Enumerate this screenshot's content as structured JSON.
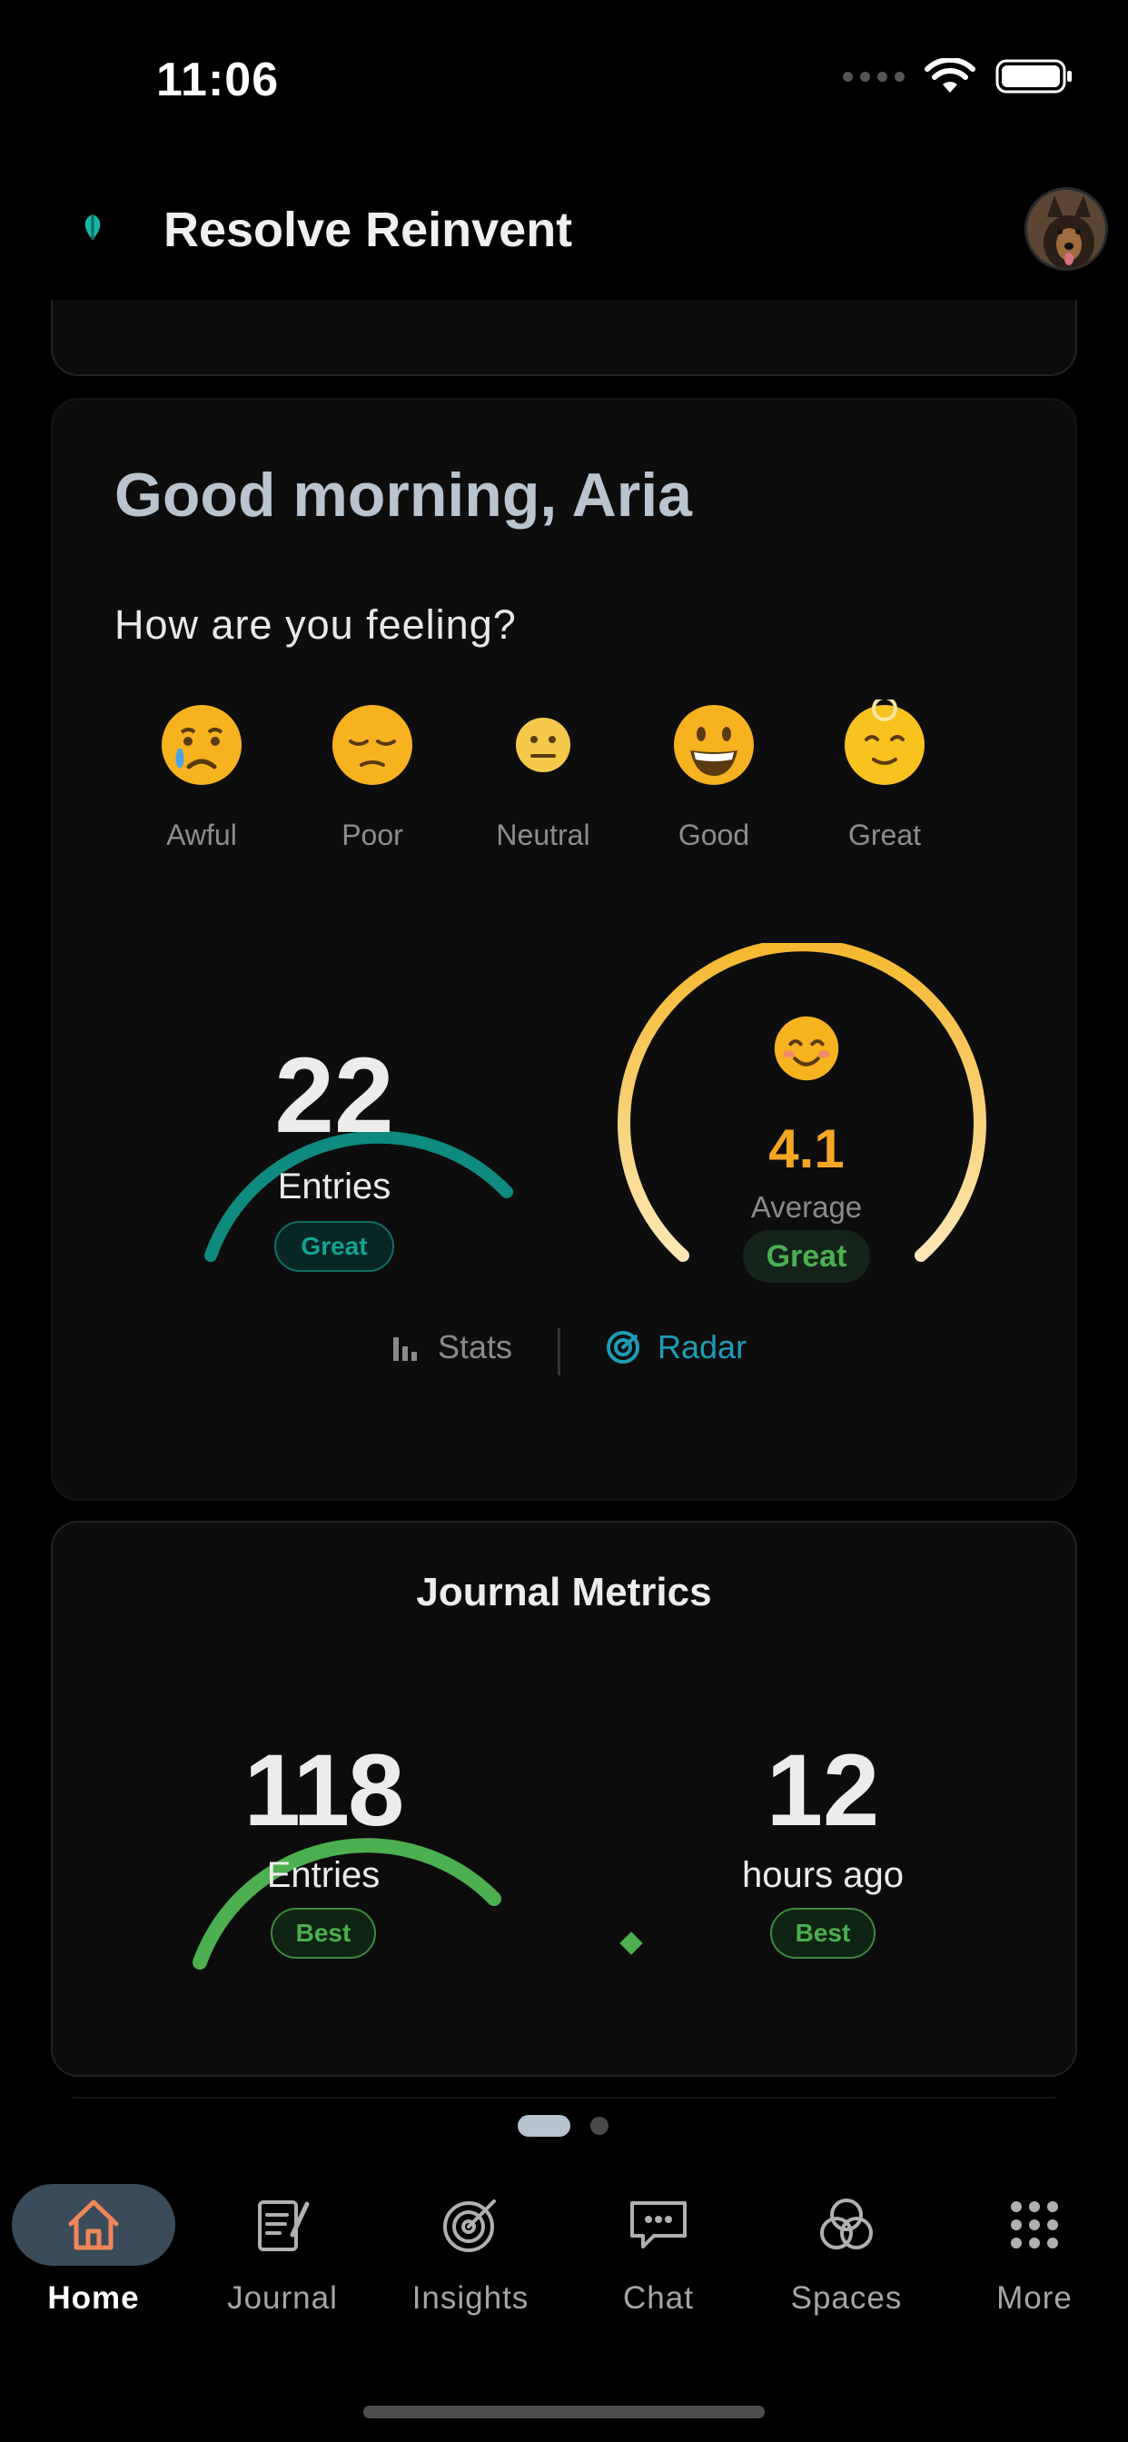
{
  "status_bar": {
    "time": "11:06"
  },
  "header": {
    "title": "Resolve Reinvent"
  },
  "mood_card": {
    "greeting": "Good morning, Aria",
    "prompt": "How are you feeling?",
    "moods": [
      {
        "label": "Awful",
        "icon": "crying-face-icon"
      },
      {
        "label": "Poor",
        "icon": "pensive-face-icon"
      },
      {
        "label": "Neutral",
        "icon": "neutral-face-icon"
      },
      {
        "label": "Good",
        "icon": "grinning-face-icon"
      },
      {
        "label": "Great",
        "icon": "relieved-face-icon"
      }
    ],
    "entries_gauge": {
      "value": "22",
      "label": "Entries",
      "badge": "Great",
      "color": "#0e8a7e"
    },
    "average_gauge": {
      "value": "4.1",
      "label": "Average",
      "badge": "Great",
      "icon": "smiling-face-icon",
      "color": "#f5b82e"
    },
    "toggles": {
      "stats": "Stats",
      "radar": "Radar",
      "active": "Radar"
    }
  },
  "metrics_card": {
    "title": "Journal Metrics",
    "entries": {
      "value": "118",
      "label": "Entries",
      "badge": "Best",
      "color": "#4caf50"
    },
    "last_entry": {
      "value": "12",
      "label": "hours ago",
      "badge": "Best"
    }
  },
  "pagination": {
    "pages": 2,
    "current": 1
  },
  "tab_bar": {
    "active": "Home",
    "tabs": [
      {
        "label": "Home",
        "icon": "home-icon"
      },
      {
        "label": "Journal",
        "icon": "journal-icon"
      },
      {
        "label": "Insights",
        "icon": "target-icon"
      },
      {
        "label": "Chat",
        "icon": "chat-bubble-icon"
      },
      {
        "label": "Spaces",
        "icon": "spaces-icon"
      },
      {
        "label": "More",
        "icon": "grid-icon"
      }
    ]
  },
  "colors": {
    "accent_teal": "#0e8a7e",
    "accent_gold": "#f5b82e",
    "accent_green": "#4caf50",
    "accent_blue": "#1e9cb6",
    "active_tab_bg": "#3a4b59"
  }
}
